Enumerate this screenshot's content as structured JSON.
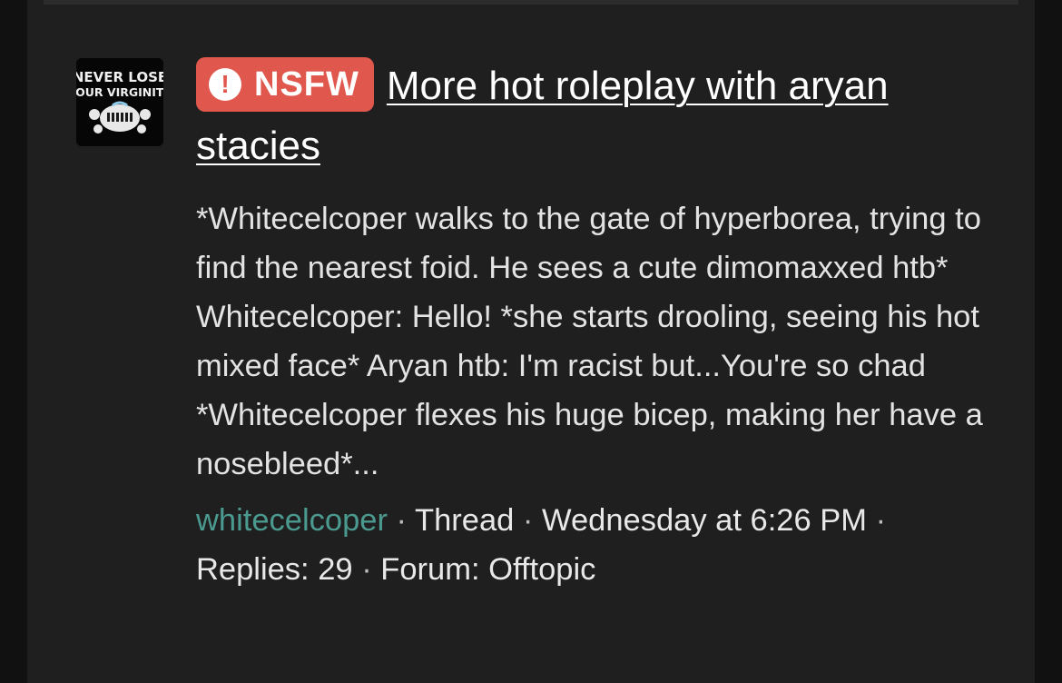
{
  "avatar": {
    "logo_line1": "NEVER LOSE",
    "logo_line2": "YOUR VIRGINITY"
  },
  "badge": {
    "label": "NSFW",
    "icon": "exclamation-circle-icon",
    "color": "#e0584d"
  },
  "thread": {
    "title": "More hot roleplay with aryan stacies",
    "snippet": "*Whitecelcoper walks to the gate of hyperborea, trying to find the nearest foid. He sees a cute dimomaxxed htb* Whitecelcoper: Hello! *she starts drooling, seeing his hot mixed face* Aryan htb: I'm racist but...You're so chad *Whitecelcoper flexes his huge bicep, making her have a nosebleed*...",
    "author": "whitecelcoper",
    "author_color": "#4b9a90",
    "type": "Thread",
    "date": "Wednesday at 6:26 PM",
    "replies": "Replies: 29",
    "forum": "Forum: Offtopic",
    "separator": "·"
  }
}
